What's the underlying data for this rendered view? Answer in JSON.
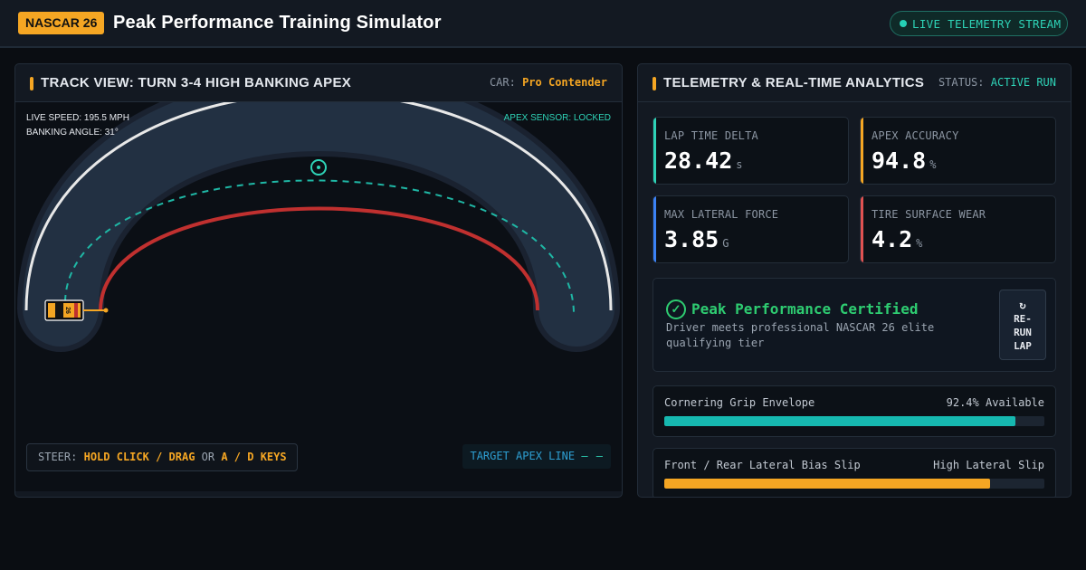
{
  "header": {
    "brand": "NASCAR 26",
    "title": "Peak Performance Training Simulator",
    "live_label": "LIVE TELEMETRY STREAM"
  },
  "track_panel": {
    "title": "TRACK VIEW: TURN 3-4 HIGH BANKING APEX",
    "car_label": "CAR:",
    "car_value": "Pro Contender",
    "hud_speed": "LIVE SPEED: 195.5 MPH",
    "hud_banking": "BANKING ANGLE: 31°",
    "hud_sensor": "APEX SENSOR: LOCKED",
    "car_number": "26",
    "steer_prefix": "STEER:",
    "steer_hold": "HOLD CLICK / DRAG",
    "steer_or": "OR",
    "steer_keys": "A / D KEYS",
    "target_label": "TARGET APEX LINE",
    "target_dash": "— —"
  },
  "telemetry_panel": {
    "title": "TELEMETRY & REAL-TIME ANALYTICS",
    "status_label": "STATUS:",
    "status_value": "ACTIVE RUN",
    "stats": [
      {
        "label": "LAP TIME DELTA",
        "value": "28.42",
        "unit": "s",
        "color": "#2ed3b7"
      },
      {
        "label": "APEX ACCURACY",
        "value": "94.8",
        "unit": "%",
        "color": "#f5a623"
      },
      {
        "label": "MAX LATERAL FORCE",
        "value": "3.85",
        "unit": "G",
        "color": "#3b82f6"
      },
      {
        "label": "TIRE SURFACE WEAR",
        "value": "4.2",
        "unit": "%",
        "color": "#e05252"
      }
    ],
    "certified": {
      "icon": "check-circle-icon",
      "title": "Peak Performance Certified",
      "subtitle": "Driver meets professional NASCAR 26 elite qualifying tier"
    },
    "rerun": {
      "icon": "↻",
      "line1": "RE-",
      "line2": "RUN",
      "line3": "LAP"
    },
    "meters": [
      {
        "label": "Cornering Grip Envelope",
        "value": "92.4% Available",
        "fraction": 0.924,
        "color": "#16b8b0"
      },
      {
        "label": "Front / Rear Lateral Bias Slip",
        "value": "High Lateral Slip",
        "fraction": 0.857,
        "color": "#f5a623"
      }
    ]
  }
}
